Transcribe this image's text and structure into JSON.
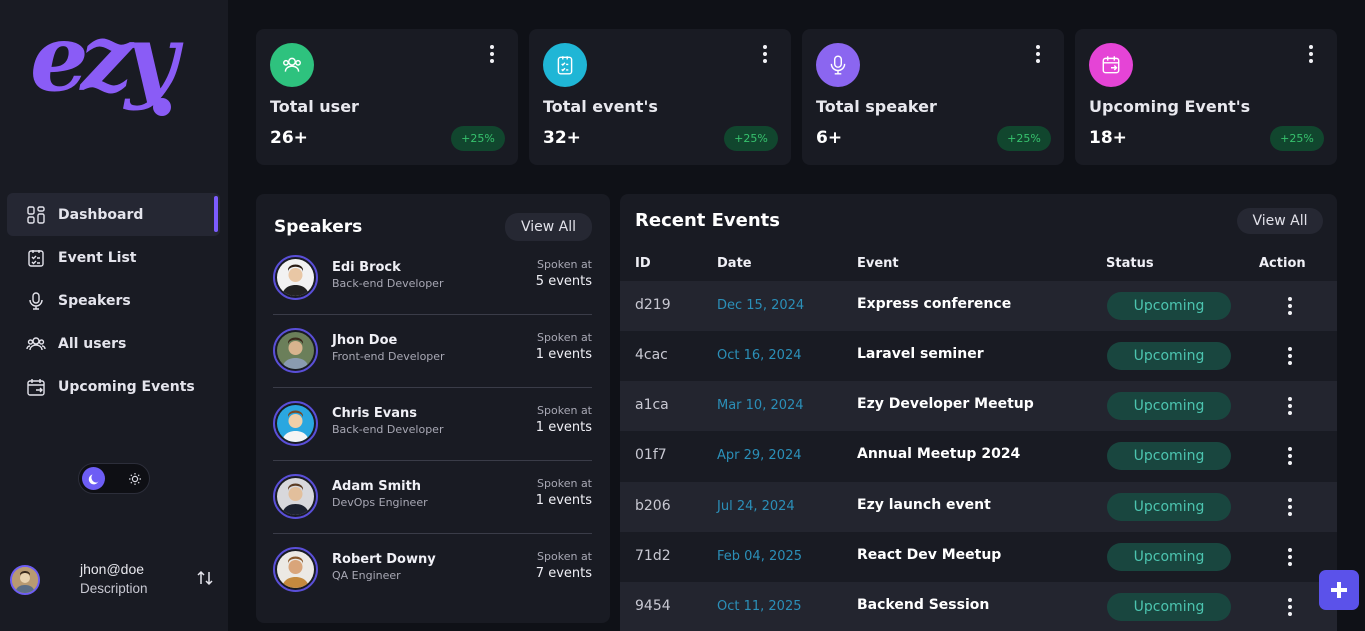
{
  "brand": {
    "logo_text": "ezy"
  },
  "colors": {
    "accent": "#6d5df5",
    "background": "#0f1117",
    "panel": "#191b23",
    "badge_green": "#37c26e",
    "status_teal": "#4cc5b0",
    "date_blue": "#2b8fb8"
  },
  "sidebar": {
    "items": [
      {
        "label": "Dashboard",
        "icon": "grid-icon",
        "active": true
      },
      {
        "label": "Event List",
        "icon": "clipboard-list-icon",
        "active": false
      },
      {
        "label": "Speakers",
        "icon": "microphone-icon",
        "active": false
      },
      {
        "label": "All users",
        "icon": "users-icon",
        "active": false
      },
      {
        "label": "Upcoming Events",
        "icon": "calendar-arrow-icon",
        "active": false
      }
    ],
    "theme": {
      "current": "dark",
      "dark_icon": "moon-icon",
      "light_icon": "sun-icon"
    },
    "user": {
      "name": "jhon@doe",
      "description": "Description"
    }
  },
  "stats": [
    {
      "title": "Total user",
      "value": "26+",
      "badge": "+25%",
      "icon": "users-icon",
      "color": "#2ec27e"
    },
    {
      "title": "Total event's",
      "value": "32+",
      "badge": "+25%",
      "icon": "clipboard-list-icon",
      "color": "#1fb6d6"
    },
    {
      "title": "Total speaker",
      "value": "6+",
      "badge": "+25%",
      "icon": "microphone-icon",
      "color": "#8b66f0"
    },
    {
      "title": "Upcoming Event's",
      "value": "18+",
      "badge": "+25%",
      "icon": "calendar-arrow-icon",
      "color": "#e544d6"
    }
  ],
  "speakers": {
    "title": "Speakers",
    "view_all": "View All",
    "items": [
      {
        "name": "Edi Brock",
        "role": "Back-end Developer",
        "spoken_label": "Spoken at",
        "count": "5 events"
      },
      {
        "name": "Jhon Doe",
        "role": "Front-end Developer",
        "spoken_label": "Spoken at",
        "count": "1 events"
      },
      {
        "name": "Chris Evans",
        "role": "Back-end Developer",
        "spoken_label": "Spoken at",
        "count": "1 events"
      },
      {
        "name": "Adam Smith",
        "role": "DevOps Engineer",
        "spoken_label": "Spoken at",
        "count": "1 events"
      },
      {
        "name": "Robert Downy",
        "role": "QA Engineer",
        "spoken_label": "Spoken at",
        "count": "7 events"
      }
    ]
  },
  "events": {
    "title": "Recent Events",
    "view_all": "View All",
    "columns": [
      "ID",
      "Date",
      "Event",
      "Status",
      "Action"
    ],
    "rows": [
      {
        "id": "d219",
        "date": "Dec 15, 2024",
        "event": "Express conference",
        "status": "Upcoming"
      },
      {
        "id": "4cac",
        "date": "Oct 16, 2024",
        "event": "Laravel seminer",
        "status": "Upcoming"
      },
      {
        "id": "a1ca",
        "date": "Mar 10, 2024",
        "event": "Ezy Developer Meetup",
        "status": "Upcoming"
      },
      {
        "id": "01f7",
        "date": "Apr 29, 2024",
        "event": "Annual Meetup 2024",
        "status": "Upcoming"
      },
      {
        "id": "b206",
        "date": "Jul 24, 2024",
        "event": "Ezy launch event",
        "status": "Upcoming"
      },
      {
        "id": "71d2",
        "date": "Feb 04, 2025",
        "event": "React Dev Meetup",
        "status": "Upcoming"
      },
      {
        "id": "9454",
        "date": "Oct 11, 2025",
        "event": "Backend Session",
        "status": "Upcoming"
      }
    ]
  },
  "fab": {
    "icon": "plus-icon"
  }
}
